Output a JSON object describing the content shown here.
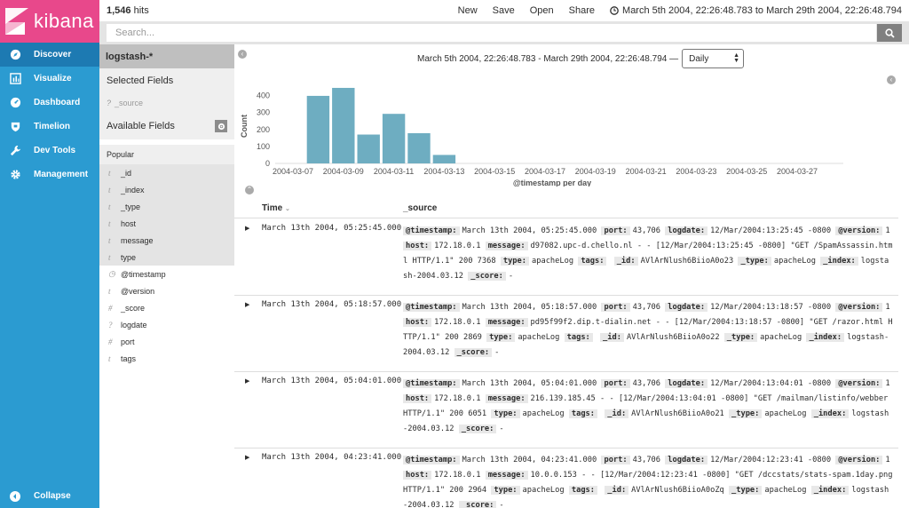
{
  "app": {
    "brand": "kibana"
  },
  "nav": {
    "items": [
      {
        "label": "Discover",
        "icon": "compass-icon"
      },
      {
        "label": "Visualize",
        "icon": "bar-chart-icon"
      },
      {
        "label": "Dashboard",
        "icon": "dashboard-icon"
      },
      {
        "label": "Timelion",
        "icon": "shield-icon"
      },
      {
        "label": "Dev Tools",
        "icon": "wrench-icon"
      },
      {
        "label": "Management",
        "icon": "gear-icon"
      }
    ],
    "collapse": "Collapse"
  },
  "topbar": {
    "hits_count": "1,546",
    "hits_label": " hits",
    "menu": [
      "New",
      "Save",
      "Open",
      "Share"
    ],
    "time_range": "March 5th 2004, 22:26:48.783 to March 29th 2004, 22:26:48.794"
  },
  "search": {
    "placeholder": "Search..."
  },
  "fields": {
    "index_pattern": "logstash-*",
    "selected_title": "Selected Fields",
    "source_field": "_source",
    "available_title": "Available Fields",
    "popular_title": "Popular",
    "popular": [
      {
        "type": "t",
        "name": "_id"
      },
      {
        "type": "t",
        "name": "_index"
      },
      {
        "type": "t",
        "name": "_type"
      },
      {
        "type": "t",
        "name": "host"
      },
      {
        "type": "t",
        "name": "message"
      },
      {
        "type": "t",
        "name": "type"
      }
    ],
    "others": [
      {
        "type": "◷",
        "name": "@timestamp"
      },
      {
        "type": "t",
        "name": "@version"
      },
      {
        "type": "#",
        "name": "_score"
      },
      {
        "type": "?",
        "name": "logdate"
      },
      {
        "type": "#",
        "name": "port"
      },
      {
        "type": "t",
        "name": "tags"
      }
    ]
  },
  "histogram": {
    "range_label": "March 5th 2004, 22:26:48.783 - March 29th 2004, 22:26:48.794 —",
    "interval": "Daily"
  },
  "chart_data": {
    "type": "bar",
    "ylabel": "Count",
    "xlabel": "@timestamp per day",
    "ylim": [
      0,
      450
    ],
    "yticks": [
      0,
      100,
      200,
      300,
      400
    ],
    "xticks": [
      "2004-03-07",
      "2004-03-09",
      "2004-03-11",
      "2004-03-13",
      "2004-03-15",
      "2004-03-17",
      "2004-03-19",
      "2004-03-21",
      "2004-03-23",
      "2004-03-25",
      "2004-03-27"
    ],
    "categories": [
      "2004-03-08",
      "2004-03-09",
      "2004-03-10",
      "2004-03-11",
      "2004-03-12",
      "2004-03-13"
    ],
    "values": [
      398,
      445,
      170,
      292,
      178,
      50
    ],
    "color": "#6eadc1"
  },
  "table": {
    "time_header": "Time",
    "source_header": "_source",
    "rows": [
      {
        "time": "March 13th 2004, 05:25:45.000",
        "fields": [
          {
            "k": "@timestamp:",
            "v": "March 13th 2004, 05:25:45.000"
          },
          {
            "k": "port:",
            "v": "43,706"
          },
          {
            "k": "logdate:",
            "v": "12/Mar/2004:13:25:45 -0800"
          },
          {
            "k": "@version:",
            "v": "1"
          },
          {
            "k": "host:",
            "v": "172.18.0.1"
          },
          {
            "k": "message:",
            "v": "d97082.upc-d.chello.nl - - [12/Mar/2004:13:25:45 -0800] \"GET /SpamAssassin.html HTTP/1.1\" 200 7368"
          },
          {
            "k": "type:",
            "v": "apacheLog"
          },
          {
            "k": "tags:",
            "v": ""
          },
          {
            "k": "_id:",
            "v": "AVlArNlush6BiioA0o23"
          },
          {
            "k": "_type:",
            "v": "apacheLog"
          },
          {
            "k": "_index:",
            "v": "logstash-2004.03.12"
          },
          {
            "k": "_score:",
            "v": "-"
          }
        ]
      },
      {
        "time": "March 13th 2004, 05:18:57.000",
        "fields": [
          {
            "k": "@timestamp:",
            "v": "March 13th 2004, 05:18:57.000"
          },
          {
            "k": "port:",
            "v": "43,706"
          },
          {
            "k": "logdate:",
            "v": "12/Mar/2004:13:18:57 -0800"
          },
          {
            "k": "@version:",
            "v": "1"
          },
          {
            "k": "host:",
            "v": "172.18.0.1"
          },
          {
            "k": "message:",
            "v": "pd95f99f2.dip.t-dialin.net - - [12/Mar/2004:13:18:57 -0800] \"GET /razor.html HTTP/1.1\" 200 2869"
          },
          {
            "k": "type:",
            "v": "apacheLog"
          },
          {
            "k": "tags:",
            "v": ""
          },
          {
            "k": "_id:",
            "v": "AVlArNlush6BiioA0o22"
          },
          {
            "k": "_type:",
            "v": "apacheLog"
          },
          {
            "k": "_index:",
            "v": "logstash-2004.03.12"
          },
          {
            "k": "_score:",
            "v": "-"
          }
        ]
      },
      {
        "time": "March 13th 2004, 05:04:01.000",
        "fields": [
          {
            "k": "@timestamp:",
            "v": "March 13th 2004, 05:04:01.000"
          },
          {
            "k": "port:",
            "v": "43,706"
          },
          {
            "k": "logdate:",
            "v": "12/Mar/2004:13:04:01 -0800"
          },
          {
            "k": "@version:",
            "v": "1"
          },
          {
            "k": "host:",
            "v": "172.18.0.1"
          },
          {
            "k": "message:",
            "v": "216.139.185.45 - - [12/Mar/2004:13:04:01 -0800] \"GET /mailman/listinfo/webber HTTP/1.1\" 200 6051"
          },
          {
            "k": "type:",
            "v": "apacheLog"
          },
          {
            "k": "tags:",
            "v": ""
          },
          {
            "k": "_id:",
            "v": "AVlArNlush6BiioA0o21"
          },
          {
            "k": "_type:",
            "v": "apacheLog"
          },
          {
            "k": "_index:",
            "v": "logstash-2004.03.12"
          },
          {
            "k": "_score:",
            "v": "-"
          }
        ]
      },
      {
        "time": "March 13th 2004, 04:23:41.000",
        "fields": [
          {
            "k": "@timestamp:",
            "v": "March 13th 2004, 04:23:41.000"
          },
          {
            "k": "port:",
            "v": "43,706"
          },
          {
            "k": "logdate:",
            "v": "12/Mar/2004:12:23:41 -0800"
          },
          {
            "k": "@version:",
            "v": "1"
          },
          {
            "k": "host:",
            "v": "172.18.0.1"
          },
          {
            "k": "message:",
            "v": "10.0.0.153 - - [12/Mar/2004:12:23:41 -0800] \"GET /dccstats/stats-spam.1day.png HTTP/1.1\" 200 2964"
          },
          {
            "k": "type:",
            "v": "apacheLog"
          },
          {
            "k": "tags:",
            "v": ""
          },
          {
            "k": "_id:",
            "v": "AVlArNlush6BiioA0oZq"
          },
          {
            "k": "_type:",
            "v": "apacheLog"
          },
          {
            "k": "_index:",
            "v": "logstash-2004.03.12"
          },
          {
            "k": "_score:",
            "v": "-"
          }
        ]
      }
    ]
  }
}
